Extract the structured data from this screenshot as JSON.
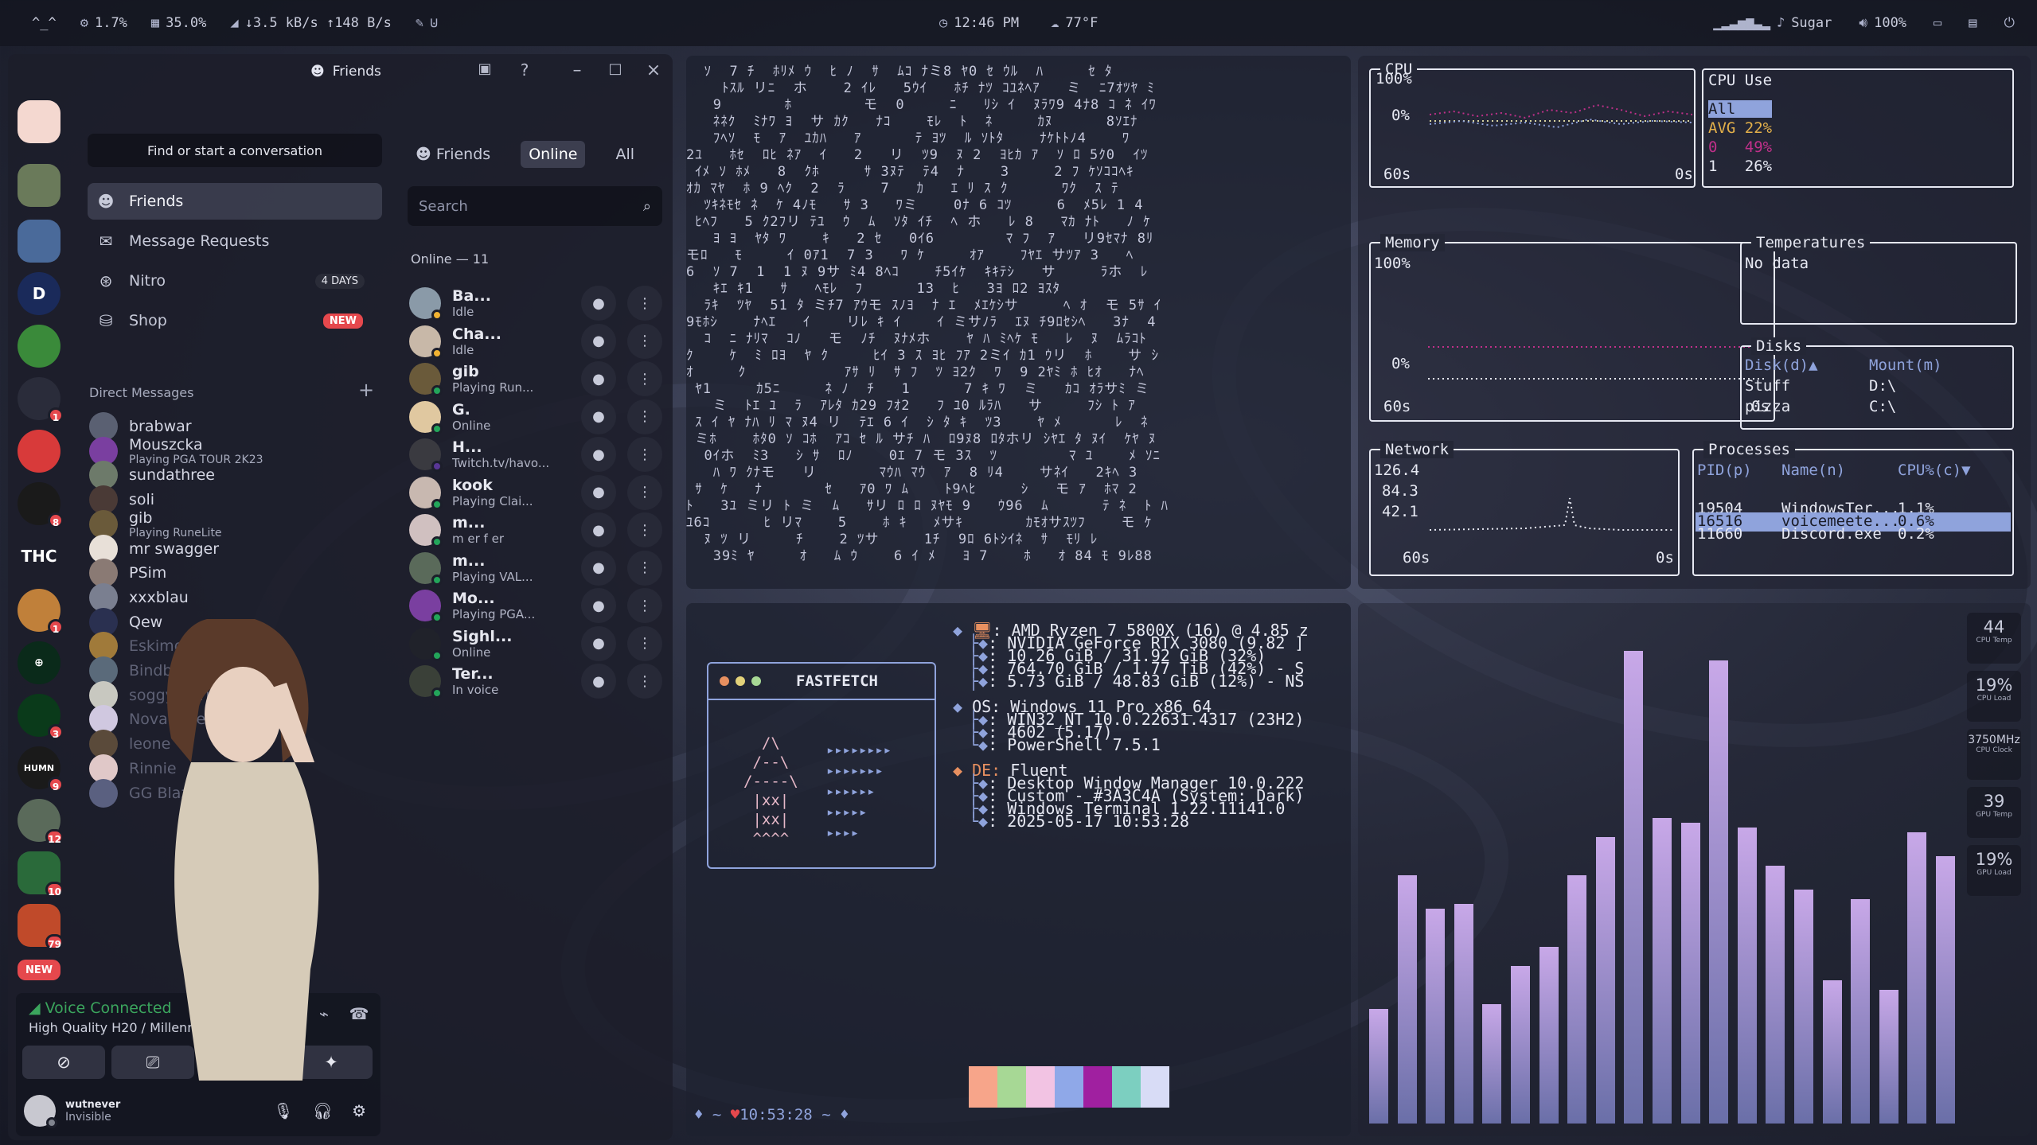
{
  "topbar": {
    "ws": "^_^",
    "cpu": "1.7%",
    "ram": "35.0%",
    "net": "↓3.5 kB/s ↑148 B/s",
    "time": "12:46 PM",
    "weather": "77°F",
    "media": "Sugar",
    "volume": "100%"
  },
  "discord": {
    "window_title": "Friends",
    "search_placeholder": "Find or start a conversation",
    "nav": [
      {
        "label": "Friends",
        "icon": "friends-icon"
      },
      {
        "label": "Message Requests",
        "icon": "mail-icon"
      },
      {
        "label": "Nitro",
        "icon": "nitro-icon",
        "pill": "4 DAYS"
      },
      {
        "label": "Shop",
        "icon": "shop-icon",
        "pill": "NEW"
      }
    ],
    "dm_header": "Direct Messages",
    "dms": [
      {
        "name": "brabwar",
        "sub": "",
        "color": "#5a6072"
      },
      {
        "name": "Mouszcka",
        "sub": "Playing PGA TOUR 2K23",
        "color": "#7a3fa0"
      },
      {
        "name": "sundathree",
        "sub": "",
        "color": "#6d7a6a"
      },
      {
        "name": "soli",
        "sub": "",
        "color": "#4a3a36"
      },
      {
        "name": "gib",
        "sub": "Playing RuneLite",
        "color": "#6a5a3a"
      },
      {
        "name": "mr swagger",
        "sub": "",
        "color": "#e8e0d8"
      },
      {
        "name": "PSim",
        "sub": "",
        "color": "#8a7a74"
      },
      {
        "name": "xxxblau",
        "sub": "",
        "color": "#7a7f90"
      },
      {
        "name": "Qew",
        "sub": "",
        "color": "#2a3050"
      },
      {
        "name": "Eskimoto",
        "sub": "",
        "color": "#a07a3a"
      },
      {
        "name": "Bindbright",
        "sub": "",
        "color": "#5a6a7a"
      },
      {
        "name": "soggyburrito450",
        "sub": "",
        "color": "#c8c8c0"
      },
      {
        "name": "NovaKane",
        "sub": "",
        "color": "#d0c8e0"
      },
      {
        "name": "leone",
        "sub": "",
        "color": "#5a4a3a"
      },
      {
        "name": "Rinnie",
        "sub": "",
        "color": "#e0c8c8"
      },
      {
        "name": "GG Blazer",
        "sub": "",
        "color": "#5a6080"
      }
    ],
    "guild_label": "THC",
    "guild_new": "NEW",
    "guild_badges": [
      "1",
      "8",
      "1",
      "3",
      "9",
      "12",
      "10",
      "79"
    ],
    "voice": {
      "status": "Voice Connected",
      "channel": "High Quality H20 / Millennium Puzzle"
    },
    "user": {
      "name": "wutnever",
      "status": "Invisible"
    },
    "friends_tabs": [
      "Friends",
      "Online",
      "All"
    ],
    "friends_search": "Search",
    "online_count": "Online — 11",
    "friends": [
      {
        "name": "Ba...",
        "sub": "Idle",
        "status": "#f0b232",
        "color": "#8a9aa8"
      },
      {
        "name": "Cha...",
        "sub": "Idle",
        "status": "#f0b232",
        "color": "#c8b8a8"
      },
      {
        "name": "gib",
        "sub": "Playing Run...",
        "status": "#23a55a",
        "color": "#6a5a3a"
      },
      {
        "name": "G.",
        "sub": "Online",
        "status": "#23a55a",
        "color": "#e0c8a0"
      },
      {
        "name": "H...",
        "sub": "Twitch.tv/havo...",
        "status": "#593695",
        "color": "#3a3a40"
      },
      {
        "name": "kook",
        "sub": "Playing Clai...",
        "status": "#23a55a",
        "color": "#c8b8b0"
      },
      {
        "name": "m...",
        "sub": "m er f er",
        "status": "#23a55a",
        "color": "#d0c0c0"
      },
      {
        "name": "m...",
        "sub": "Playing VAL...",
        "status": "#23a55a",
        "color": "#5a6a5a"
      },
      {
        "name": "Mo...",
        "sub": "Playing PGA...",
        "status": "#23a55a",
        "color": "#7a3fa0"
      },
      {
        "name": "Sighl...",
        "sub": "Online",
        "status": "#23a55a",
        "color": "#20222a"
      },
      {
        "name": "Ter...",
        "sub": "In voice",
        "status": "#23a55a",
        "color": "#3a4038"
      }
    ]
  },
  "btop": {
    "cpu_title": "CPU",
    "cpu_use_title": "CPU Use",
    "cpu_y_top": "100%",
    "cpu_y_bot": "0%",
    "cpu_x_left": "60s",
    "cpu_x_right": "0s",
    "cpu_use_rows": [
      "All",
      "AVG 22%",
      "0   49%",
      "1   26%"
    ],
    "mem_title": "Memory",
    "mem_y_top": "100%",
    "mem_y_bot": "0%",
    "mem_x_left": "60s",
    "mem_x_right": "0s",
    "temp_title": "Temperatures",
    "temp_text": "No data",
    "disks_title": "Disks",
    "disk_head_a": "Disk(d)▲",
    "disk_head_b": "Mount(m)",
    "disks": [
      [
        "Stuff",
        "D:\\"
      ],
      [
        "pizza",
        "C:\\"
      ]
    ],
    "net_title": "Network",
    "net_vals": [
      "126.4",
      "84.3",
      "42.1"
    ],
    "net_x_left": "60s",
    "net_x_right": "0s",
    "proc_title": "Processes",
    "proc_head": [
      "PID(p)",
      "Name(n)",
      "CPU%(c)▼"
    ],
    "procs": [
      [
        "19504",
        "WindowsTer...",
        "1.1%"
      ],
      [
        "16516",
        "voicemeete...",
        "0.6%"
      ],
      [
        "11660",
        "Discord.exe",
        "0.2%"
      ]
    ]
  },
  "fastfetch": {
    "title": "FASTFETCH",
    "logo": "  /\\\n /--\\\n/----\\\n |xx|\n |xx|\n ^^^^",
    "arrows": "▸▸▸▸▸▸▸▸\n▸▸▸▸▸▸▸\n▸▸▸▸▸▸\n▸▸▸▸▸\n▸▸▸▸",
    "hw_lines": [
      "AMD Ryzen 7 5800X (16) @ 4.85 z",
      "NVIDIA GeForce RTX 3080 (9.82 ]",
      "10.26 GiB / 31.92 GiB (32%)",
      "764.70 GiB / 1.77 TiB (42%) - S",
      "5.73 GiB / 48.83 GiB (12%) - NS"
    ],
    "os_key": "OS:",
    "os_lines": [
      "Windows 11 Pro x86_64",
      "WIN32_NT 10.0.22631.4317 (23H2)",
      "4602 (5.17)",
      "PowerShell 7.5.1"
    ],
    "de_key": "DE:",
    "de_lines": [
      "Fluent",
      "Desktop Window Manager 10.0.222",
      "Custom - #3A3C4A (System: Dark)",
      "Windows Terminal 1.22.11141.0",
      "2025-05-17 10:53:28"
    ],
    "palette": [
      "#f7a58a",
      "#a7d895",
      "#f2c3e3",
      "#8fa8e8",
      "#a020a0",
      "#7ccfc0",
      "#d8dcf6"
    ],
    "palette_low": [
      "#5a5f78",
      "#e88a8a"
    ],
    "prompt_pre": "♦ ~",
    "prompt_time": "10:53:28",
    "prompt_post": "~ ♦"
  },
  "visualizer": {
    "values": [
      0.24,
      0.52,
      0.45,
      0.46,
      0.25,
      0.33,
      0.37,
      0.52,
      0.6,
      0.99,
      0.64,
      0.63,
      0.97,
      0.62,
      0.54,
      0.49,
      0.3,
      0.47,
      0.28,
      0.61,
      0.56
    ],
    "widgets": [
      {
        "val": "44",
        "lbl": "CPU Temp"
      },
      {
        "val": "19%",
        "lbl": "CPU Load"
      },
      {
        "val": "3750MHz",
        "lbl": "CPU Clock"
      },
      {
        "val": "39",
        "lbl": "GPU Temp"
      },
      {
        "val": "19%",
        "lbl": "GPU Load"
      }
    ]
  }
}
